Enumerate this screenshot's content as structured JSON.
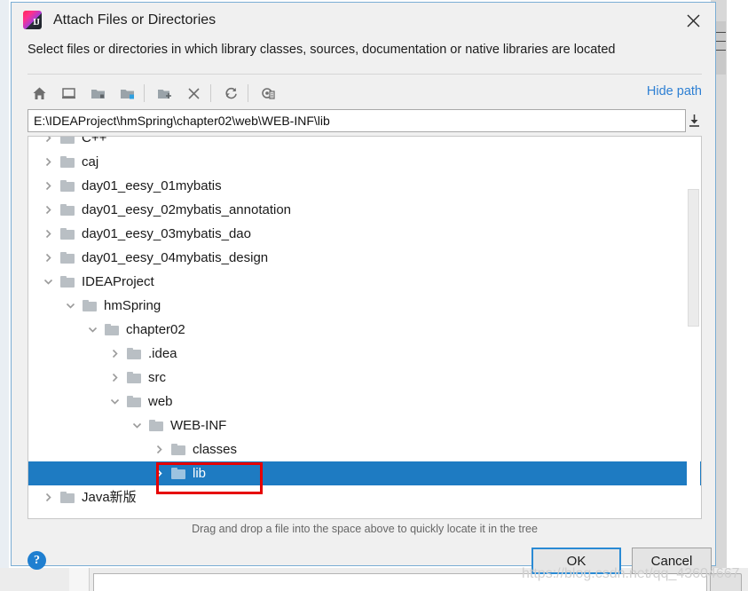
{
  "window": {
    "title": "Attach Files or Directories",
    "app_icon": "intellij-idea-icon",
    "close_label": "✕"
  },
  "subtitle": "Select files or directories in which library classes, sources, documentation or native libraries are located",
  "toolbar": {
    "buttons": [
      {
        "name": "home-icon",
        "tooltip": "Home"
      },
      {
        "name": "desktop-icon",
        "tooltip": "Desktop"
      },
      {
        "name": "project-folder-icon",
        "tooltip": "Project Directory"
      },
      {
        "name": "module-folder-icon",
        "tooltip": "Module Directory"
      },
      {
        "name": "new-folder-icon",
        "tooltip": "New Folder"
      },
      {
        "name": "delete-icon",
        "tooltip": "Delete"
      },
      {
        "name": "refresh-icon",
        "tooltip": "Refresh"
      },
      {
        "name": "show-hidden-icon",
        "tooltip": "Show Hidden Files"
      }
    ],
    "hide_path_label": "Hide path"
  },
  "path": {
    "value": "E:\\IDEAProject\\hmSpring\\chapter02\\web\\WEB-INF\\lib",
    "placeholder": "",
    "drop_icon": "insert-path-icon"
  },
  "tree": {
    "rows": [
      {
        "label": "C++",
        "depth": 1,
        "state": "collapsed",
        "selected": false
      },
      {
        "label": "caj",
        "depth": 1,
        "state": "collapsed",
        "selected": false
      },
      {
        "label": "day01_eesy_01mybatis",
        "depth": 1,
        "state": "collapsed",
        "selected": false
      },
      {
        "label": "day01_eesy_02mybatis_annotation",
        "depth": 1,
        "state": "collapsed",
        "selected": false
      },
      {
        "label": "day01_eesy_03mybatis_dao",
        "depth": 1,
        "state": "collapsed",
        "selected": false
      },
      {
        "label": "day01_eesy_04mybatis_design",
        "depth": 1,
        "state": "collapsed",
        "selected": false
      },
      {
        "label": "IDEAProject",
        "depth": 1,
        "state": "expanded",
        "selected": false
      },
      {
        "label": "hmSpring",
        "depth": 2,
        "state": "expanded",
        "selected": false
      },
      {
        "label": "chapter02",
        "depth": 3,
        "state": "expanded",
        "selected": false
      },
      {
        "label": ".idea",
        "depth": 4,
        "state": "collapsed",
        "selected": false
      },
      {
        "label": "src",
        "depth": 4,
        "state": "collapsed",
        "selected": false
      },
      {
        "label": "web",
        "depth": 4,
        "state": "expanded",
        "selected": false
      },
      {
        "label": "WEB-INF",
        "depth": 5,
        "state": "expanded",
        "selected": false
      },
      {
        "label": "classes",
        "depth": 6,
        "state": "collapsed",
        "selected": false
      },
      {
        "label": "lib",
        "depth": 6,
        "state": "collapsed",
        "selected": true
      },
      {
        "label": "Java新版",
        "depth": 1,
        "state": "collapsed",
        "selected": false
      }
    ],
    "selected_label": "lib",
    "scrollbar": "vertical-scrollbar"
  },
  "annotation": {
    "shape": "rectangle",
    "color": "#e60000",
    "targets": "lib"
  },
  "hint": "Drag and drop a file into the space above to quickly locate it in the tree",
  "footer": {
    "help_label": "?",
    "ok_label": "OK",
    "cancel_label": "Cancel"
  },
  "watermark": "https://blog.csdn.net/qq_43604667",
  "colors": {
    "selection": "#1e7bc2",
    "link": "#2d7fd3",
    "annotation": "#e60000",
    "dialog_bg": "#f0f0f0",
    "dialog_border": "#7aadd4"
  }
}
